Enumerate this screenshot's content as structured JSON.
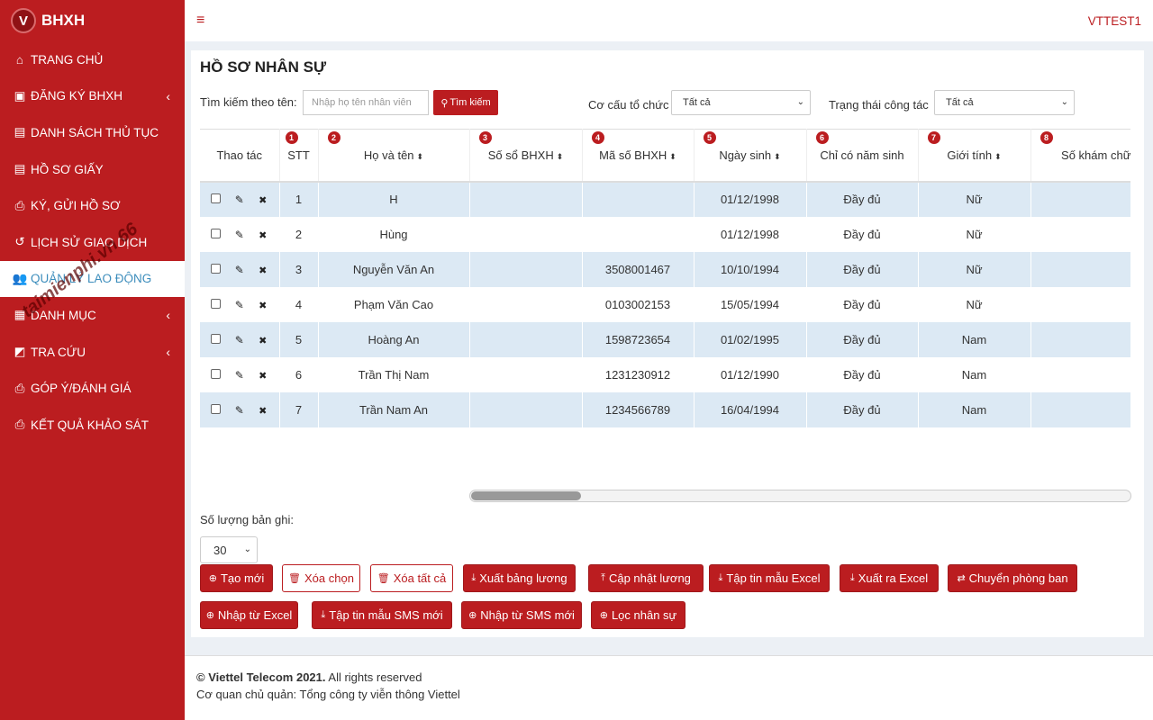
{
  "brand": {
    "name": "BHXH",
    "logo_letter": "V"
  },
  "sidebar": {
    "items": [
      {
        "label": "TRANG CHỦ",
        "icon": "home-icon",
        "glyph": "⌂"
      },
      {
        "label": "ĐĂNG KÝ BHXH",
        "icon": "book-icon",
        "glyph": "▣",
        "chevron": "‹"
      },
      {
        "label": "DANH SÁCH THỦ TỤC",
        "icon": "file-icon",
        "glyph": "▤"
      },
      {
        "label": "HỒ SƠ GIẤY",
        "icon": "file-icon",
        "glyph": "▤"
      },
      {
        "label": "KÝ, GỬI HỒ SƠ",
        "icon": "print-icon",
        "glyph": "⎙"
      },
      {
        "label": "LỊCH SỬ GIAO DỊCH",
        "icon": "history-icon",
        "glyph": "↺"
      },
      {
        "label": "QUẢN LÝ LAO ĐỘNG",
        "icon": "users-icon",
        "glyph": "👥"
      },
      {
        "label": "DANH MỤC",
        "icon": "table-icon",
        "glyph": "▦",
        "chevron": "‹"
      },
      {
        "label": "TRA CỨU",
        "icon": "search-doc-icon",
        "glyph": "◩",
        "chevron": "‹"
      },
      {
        "label": "GÓP Ý/ĐÁNH GIÁ",
        "icon": "print-icon",
        "glyph": "⎙"
      },
      {
        "label": "KẾT QUẢ KHẢO SÁT",
        "icon": "print-icon",
        "glyph": "⎙"
      }
    ]
  },
  "watermark": "taimienphi.vn 66",
  "topbar": {
    "menu_icon": "≡",
    "user": "VTTEST1"
  },
  "page": {
    "title": "HỒ SƠ NHÂN SỰ"
  },
  "search": {
    "label": "Tìm kiếm theo tên:",
    "placeholder": "Nhập họ tên nhân viên",
    "button": "Tìm kiếm",
    "org_label": "Cơ cấu tổ chức",
    "org_value": "Tất cả",
    "status_label": "Trạng thái công tác",
    "status_value": "Tất cả"
  },
  "table": {
    "headers": [
      {
        "label": "Thao tác"
      },
      {
        "label": "STT",
        "badge": "1"
      },
      {
        "label": "Họ và tên",
        "badge": "2",
        "sort": true
      },
      {
        "label": "Số sổ BHXH",
        "badge": "3",
        "sort": true
      },
      {
        "label": "Mã số BHXH",
        "badge": "4",
        "sort": true
      },
      {
        "label": "Ngày sinh",
        "badge": "5",
        "sort": true
      },
      {
        "label": "Chỉ có năm sinh",
        "badge": "6"
      },
      {
        "label": "Giới tính",
        "badge": "7",
        "sort": true
      },
      {
        "label": "Số khám chữa bện",
        "badge": "8"
      }
    ],
    "rows": [
      {
        "stt": "1",
        "name": "H",
        "so_so": "",
        "ma_so": "",
        "dob": "01/12/1998",
        "year_only": "Đầy đủ",
        "gender": "Nữ",
        "kcb": ""
      },
      {
        "stt": "2",
        "name": "Hùng",
        "so_so": "",
        "ma_so": "",
        "dob": "01/12/1998",
        "year_only": "Đầy đủ",
        "gender": "Nữ",
        "kcb": ""
      },
      {
        "stt": "3",
        "name": "Nguyễn Văn An",
        "so_so": "",
        "ma_so": "3508001467",
        "dob": "10/10/1994",
        "year_only": "Đầy đủ",
        "gender": "Nữ",
        "kcb": ""
      },
      {
        "stt": "4",
        "name": "Phạm Văn Cao",
        "so_so": "",
        "ma_so": "0103002153",
        "dob": "15/05/1994",
        "year_only": "Đầy đủ",
        "gender": "Nữ",
        "kcb": ""
      },
      {
        "stt": "5",
        "name": "Hoàng An",
        "so_so": "",
        "ma_so": "1598723654",
        "dob": "01/02/1995",
        "year_only": "Đầy đủ",
        "gender": "Nam",
        "kcb": ""
      },
      {
        "stt": "6",
        "name": "Trần Thị Nam",
        "so_so": "",
        "ma_so": "1231230912",
        "dob": "01/12/1990",
        "year_only": "Đầy đủ",
        "gender": "Nam",
        "kcb": ""
      },
      {
        "stt": "7",
        "name": "Trần Nam An",
        "so_so": "",
        "ma_so": "1234566789",
        "dob": "16/04/1994",
        "year_only": "Đầy đủ",
        "gender": "Nam",
        "kcb": ""
      }
    ]
  },
  "records": {
    "label": "Số lượng bản ghi:",
    "value": "30"
  },
  "buttons": {
    "row1": [
      {
        "label": "Tạo mới",
        "icon": "plus-circle-icon",
        "glyph": "⊕",
        "style": "fill"
      },
      {
        "label": "Xóa chọn",
        "icon": "trash-icon",
        "glyph": "🗑",
        "style": "outline"
      },
      {
        "label": "Xóa tất cả",
        "icon": "trash-icon",
        "glyph": "🗑",
        "style": "outline"
      },
      {
        "label": "Xuất bảng lương",
        "icon": "download-icon",
        "glyph": "⤓",
        "style": "fill"
      },
      {
        "label": "Cập nhật lương",
        "icon": "upload-icon",
        "glyph": "⤒",
        "style": "fill"
      },
      {
        "label": "Tập tin mẫu Excel",
        "icon": "download-icon",
        "glyph": "⤓",
        "style": "fill"
      },
      {
        "label": "Xuất ra Excel",
        "icon": "download-icon",
        "glyph": "⤓",
        "style": "fill"
      },
      {
        "label": "Chuyển phòng ban",
        "icon": "exchange-icon",
        "glyph": "⇄",
        "style": "fill"
      }
    ],
    "row2": [
      {
        "label": "Nhập từ Excel",
        "icon": "plus-circle-icon",
        "glyph": "⊕",
        "style": "fill"
      },
      {
        "label": "Tập tin mẫu SMS mới",
        "icon": "download-icon",
        "glyph": "⤓",
        "style": "fill"
      },
      {
        "label": "Nhập từ SMS mới",
        "icon": "plus-circle-icon",
        "glyph": "⊕",
        "style": "fill"
      },
      {
        "label": "Lọc nhân sự",
        "icon": "plus-circle-icon",
        "glyph": "⊕",
        "style": "fill"
      }
    ]
  },
  "footer": {
    "copyright": "© Viettel Telecom 2021.",
    "rights": " All rights reserved",
    "owner": "Cơ quan chủ quản: Tổng công ty viễn thông Viettel"
  },
  "colors": {
    "brand": "#bb1d20",
    "active_text": "#3c8dbc",
    "row_alt": "#dce9f4"
  }
}
